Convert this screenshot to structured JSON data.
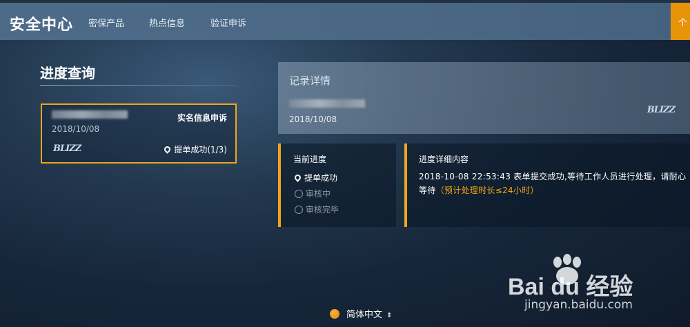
{
  "header": {
    "logo": "安全中心",
    "nav": [
      "密保产品",
      "热点信息",
      "验证申诉"
    ],
    "account_label": "个"
  },
  "query": {
    "title": "进度查询",
    "card": {
      "date": "2018/10/08",
      "type": "实名信息申诉",
      "logo_text": "BLIZZ",
      "status": "提单成功(1/3)"
    }
  },
  "detail": {
    "title": "记录详情",
    "date": "2018/10/08",
    "logo_text": "BLIZZ"
  },
  "progress": {
    "title": "当前进度",
    "steps": [
      "提单成功",
      "审核中",
      "审核完毕"
    ]
  },
  "content": {
    "title": "进度详细内容",
    "text": "2018-10-08 22:53:43 表单提交成功,等待工作人员进行处理，请耐心等待",
    "note": "（预计处理时长≤24小时）"
  },
  "footer": {
    "language": "简体中文"
  },
  "watermark": {
    "brand": "Bai du 经验",
    "url": "jingyan.baidu.com"
  },
  "colors": {
    "accent": "#f2a51a",
    "nav_bg": "#4a6784"
  }
}
